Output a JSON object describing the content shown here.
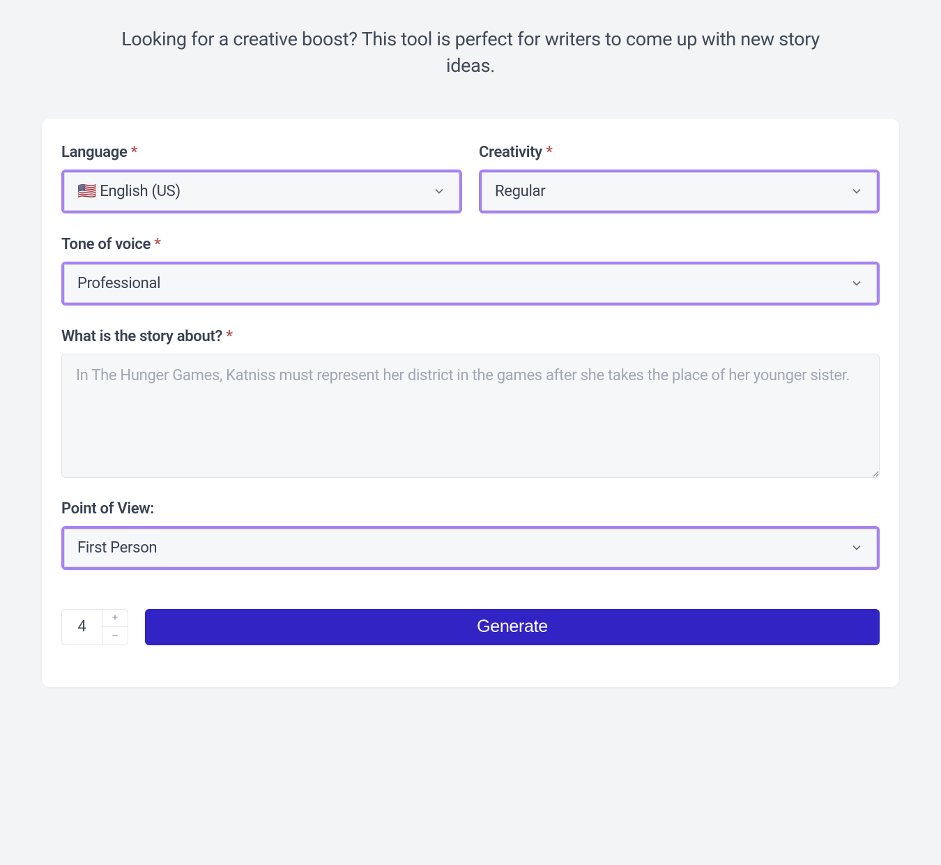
{
  "header": {
    "subtitle": "Looking for a creative boost? This tool is perfect for writers to come up with new story ideas."
  },
  "form": {
    "language": {
      "label": "Language",
      "required": "*",
      "value": "🇺🇸 English (US)"
    },
    "creativity": {
      "label": "Creativity",
      "required": "*",
      "value": "Regular"
    },
    "tone": {
      "label": "Tone of voice",
      "required": "*",
      "value": "Professional"
    },
    "story": {
      "label": "What is the story about?",
      "required": "*",
      "placeholder": "In The Hunger Games, Katniss must represent her district in the games after she takes the place of her younger sister."
    },
    "pov": {
      "label": "Point of View:",
      "value": "First Person"
    },
    "count": {
      "value": "4"
    },
    "generate": {
      "label": "Generate"
    }
  }
}
